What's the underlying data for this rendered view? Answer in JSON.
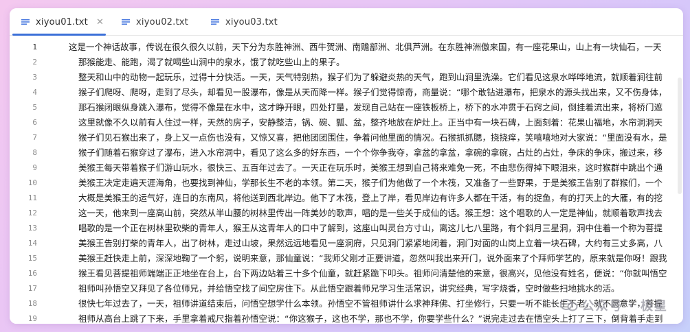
{
  "tabs": [
    {
      "label": "xiyou01.txt",
      "active": true
    },
    {
      "label": "xiyou02.txt",
      "active": false
    },
    {
      "label": "xiyou03.txt",
      "active": false
    }
  ],
  "lines": [
    {
      "number": "1",
      "text": "这是一个神话故事，传说在很久很久以前，天下分为东胜神洲、西牛贺洲、南赡部洲、北俱芦洲。在东胜神洲傲来国，有一座花果山，山上有一块仙石，一天"
    },
    {
      "number": "2",
      "text": "那猴能走、能跑，渴了就喝些山涧中的泉水，饿了就吃些山上的果子。"
    },
    {
      "number": "3",
      "text": "整天和山中的动物一起玩乐，过得十分快活。一天，天气特别热，猴子们为了躲避炎热的天气，跑到山涧里洗澡。它们看见这泉水哗哗地流，就顺着涧往前"
    },
    {
      "number": "4",
      "text": "猴子们爬呀、爬呀，走到了尽头，却看见一股瀑布，像是从天而降一样。猴子们觉得惊奇，商量说：“哪个敢钻进瀑布，把泉水的源头找出来，又不伤身体，"
    },
    {
      "number": "5",
      "text": "那石猴闭眼纵身跳入瀑布，觉得不像是在水中，这才睁开眼，四处打量，发现自己站在一座铁板桥上，桥下的水冲贯于石窍之间，倒挂着流出来，将桥门遮"
    },
    {
      "number": "6",
      "text": "这里就像不久以前有人住过一样，天然的房子，安静整洁，锅、碗、瓢、盆，整齐地放在炉灶上。正当中有一块石碑，上面刻着：花果山福地，水帘洞洞天"
    },
    {
      "number": "7",
      "text": "猴子们见石猴出来了，身上又一点伤也没有，又惊又喜，把他团团围住，争着问他里面的情况。石猴抓抓腮，挠挠痒，笑嘻嘻地对大家说：“里面没有水，是"
    },
    {
      "number": "8",
      "text": "猴子们随着石猴穿过了瀑布，进入水帘洞中，看见了这么多的好东西，一个个你争我夺，拿盆的拿盆，拿碗的拿碗，占灶的占灶，争床的争床，搬过来，移"
    },
    {
      "number": "9",
      "text": "美猴王每天带着猴子们游山玩水，很快三、五百年过去了。一天正在玩乐时，美猴王想到自己将来难免一死，不由悲伤得掉下眼泪来，这时猴群中跳出个通"
    },
    {
      "number": "10",
      "text": "美猴王决定走遍天涯海角，也要找到神仙，学那长生不老的本领。第二天，猴子们为他做了一个木筏，又准备了一些野果，于是美猴王告别了群猴们，一个"
    },
    {
      "number": "11",
      "text": "大概是美猴王的运气好，连日的东南风，将他送到西北岸边。他下了木筏，登上了岸，看见岸边有许多人都在干活，有的捉鱼，有的打天上的大雁，有的挖"
    },
    {
      "number": "12",
      "text": "这一天，他来到一座高山前，突然从半山腰的树林里传出一阵美妙的歌声，唱的是一些关于成仙的话。猴王想：这个唱歌的人一定是神仙，就顺着歌声找去"
    },
    {
      "number": "13",
      "text": "唱歌的是一个正在树林里砍柴的青年人，猴王从这青年人的口中了解到，这座山叫灵台方寸山，离这儿七八里路，有个斜月三星洞，洞中住着一个称为菩提"
    },
    {
      "number": "14",
      "text": "美猴王告别打柴的青年人，出了树林，走过山坡，果然远远地看见一座洞府，只见洞门紧紧地闭着，洞门对面的山岗上立着一块石碑，大约有三丈多高，八"
    },
    {
      "number": "15",
      "text": "美猴王赶快走上前，深深地鞠了一个躬，说明来意，那仙童说：“我师父刚才正要讲道，忽然叫我出来开门，说外面来了个拜师学艺的，原来就是你呀！跟我"
    },
    {
      "number": "16",
      "text": "猴王看见菩提祖师端端正正地坐在台上，台下两边站着三十多个仙童，就赶紧跪下叩头。祖师问清楚他的来意，很高兴，见他没有姓名，便说：“你就叫悟空"
    },
    {
      "number": "17",
      "text": "祖师叫孙悟空又拜见了各位师兄，并给悟空找了间空房住下。从此悟空跟着师兄学习生活常识，讲究经典，写字烧香，空时做些扫地挑水的活。"
    },
    {
      "number": "18",
      "text": "很快七年过去了，一天，祖师讲道结束后，问悟空想学什么本领。孙悟空不管祖师讲什么求神拜佛、打坐修行，只要一听不能长生不老，就不愿意学，菩提"
    },
    {
      "number": "19",
      "text": "祖师从高台上跳了下来，手里拿着戒尺指着孙悟空说：“你这猴子，这也不学，那也不学，你要学些什么？”说完走过去在悟空头上打了三下，倒背着手走到"
    }
  ],
  "watermark": "公众号 · 极星",
  "colors": {
    "accent": "#3b6fd8",
    "icon_blue": "#4c7be0"
  }
}
